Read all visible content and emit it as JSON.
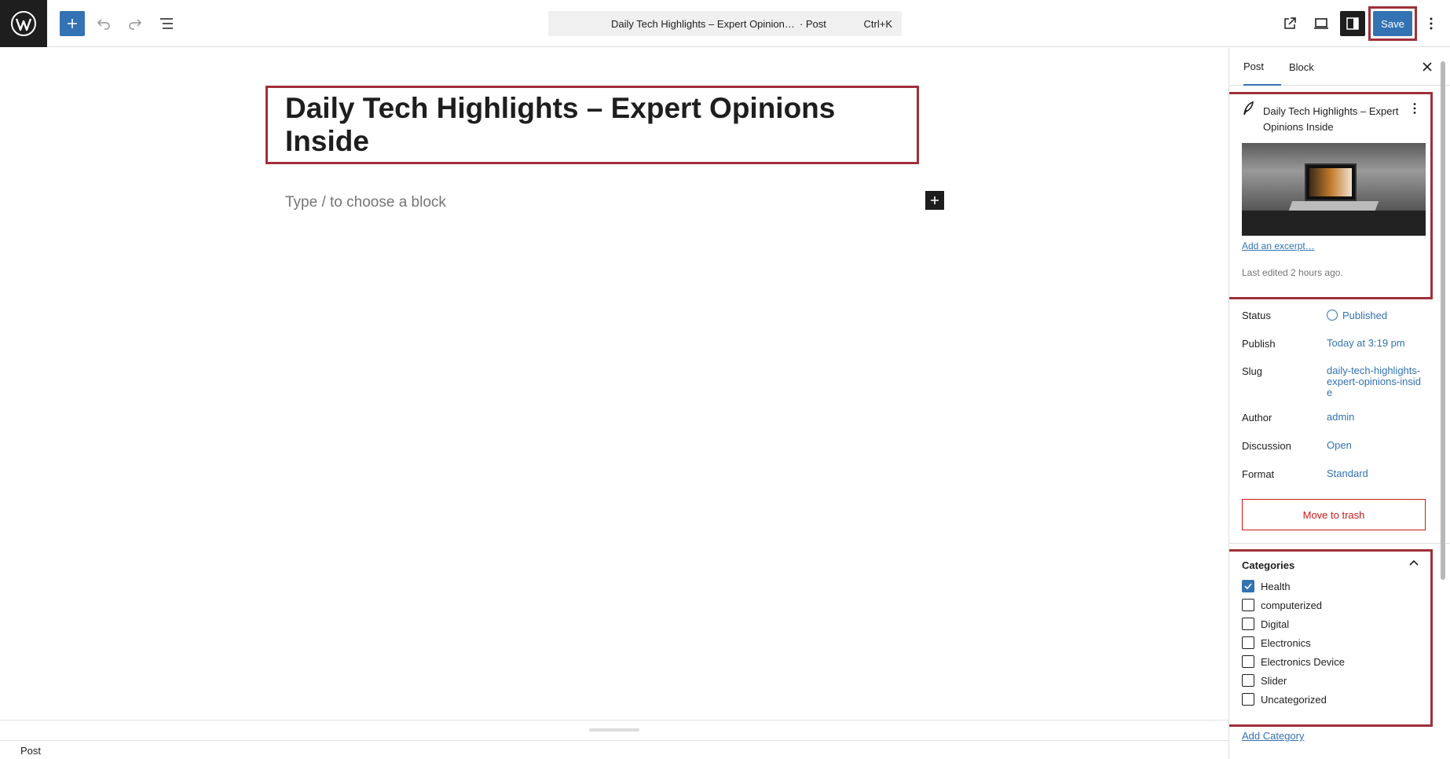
{
  "app": {
    "logo": "wordpress-logo"
  },
  "toolbar": {
    "inserter_icon": "plus-icon",
    "undo_icon": "undo-icon",
    "redo_icon": "redo-icon",
    "list_view_icon": "list-view-icon",
    "command": {
      "title": "Daily Tech Highlights – Expert Opinion…",
      "type": "· Post",
      "shortcut": "Ctrl+K"
    },
    "view_post_icon": "external-link-icon",
    "preview_icon": "laptop-icon",
    "settings_icon": "sidebar-icon",
    "save_label": "Save",
    "options_icon": "more-vertical-icon"
  },
  "editor": {
    "title": "Daily Tech Highlights – Expert Opinions Inside",
    "block_placeholder": "Type / to choose a block"
  },
  "statusbar": {
    "breadcrumb": "Post"
  },
  "sidebar": {
    "tabs": [
      {
        "label": "Post"
      },
      {
        "label": "Block"
      }
    ],
    "summary": {
      "title": "Daily Tech Highlights – Expert Opinions Inside",
      "excerpt_link": "Add an excerpt…",
      "last_edited": "Last edited 2 hours ago."
    },
    "meta": [
      {
        "key": "Status",
        "value": "Published"
      },
      {
        "key": "Publish",
        "value": "Today at 3:19 pm"
      },
      {
        "key": "Slug",
        "value": "daily-tech-highlights-expert-opinions-inside"
      },
      {
        "key": "Author",
        "value": "admin"
      },
      {
        "key": "Discussion",
        "value": "Open"
      },
      {
        "key": "Format",
        "value": "Standard"
      }
    ],
    "trash_label": "Move to trash",
    "categories": {
      "heading": "Categories",
      "items": [
        {
          "label": "Health",
          "checked": true
        },
        {
          "label": "computerized",
          "checked": false
        },
        {
          "label": "Digital",
          "checked": false
        },
        {
          "label": "Electronics",
          "checked": false
        },
        {
          "label": "Electronics Device",
          "checked": false
        },
        {
          "label": "Slider",
          "checked": false
        },
        {
          "label": "Uncategorized",
          "checked": false
        }
      ],
      "add_link": "Add Category"
    }
  }
}
